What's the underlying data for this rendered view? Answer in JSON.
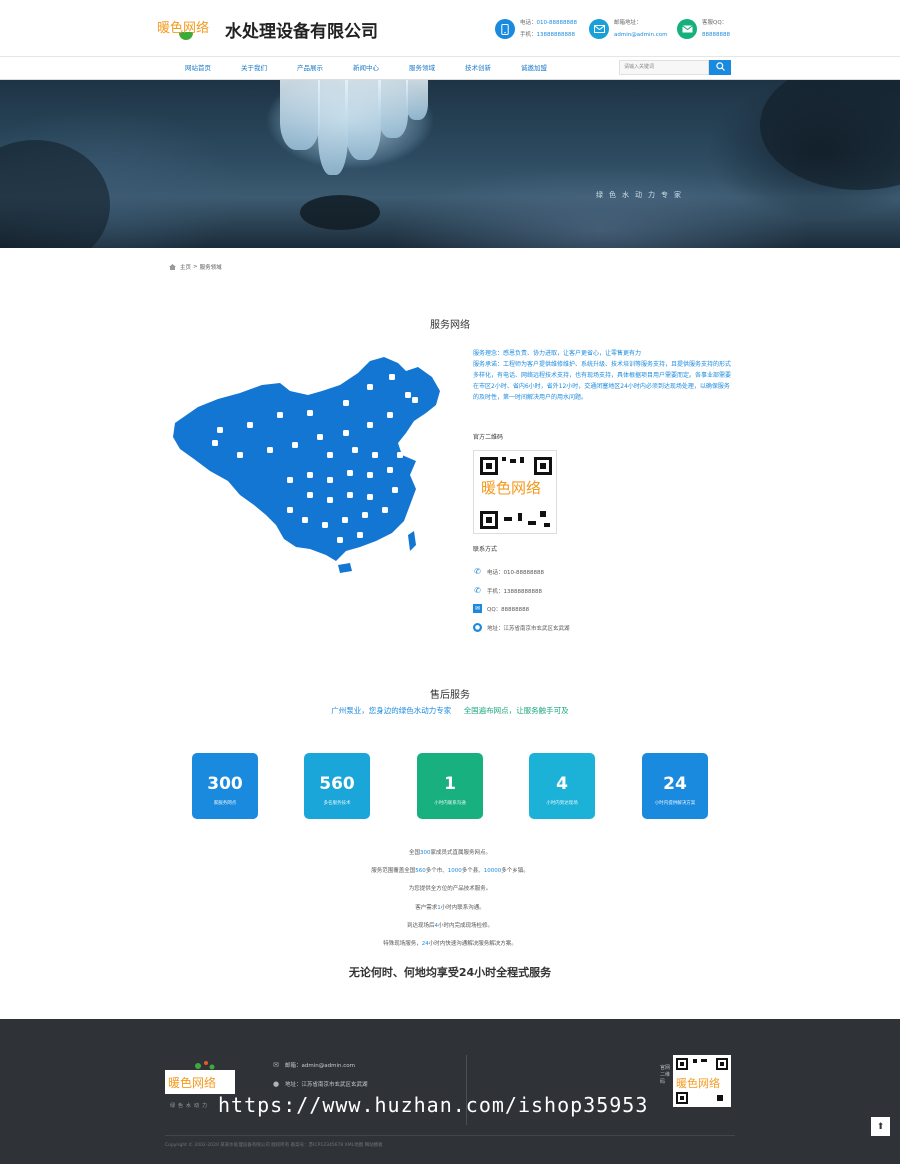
{
  "header": {
    "logo_text": "暖色网络",
    "company_name": "水处理设备有限公司",
    "phone_label": "电话：",
    "phone_value": "010-88888888",
    "mobile_label": "手机：",
    "mobile_value": "13888888888",
    "email_label": "邮箱地址：",
    "email_value": "admin@admin.com",
    "qq_label": "客服QQ：",
    "qq_value": "88888888",
    "colors": {
      "phone": "#1a8adf",
      "email": "#1aa0d8",
      "qq": "#16b07d"
    }
  },
  "nav": {
    "items": [
      "网站首页",
      "关于我们",
      "产品展示",
      "新闻中心",
      "服务领域",
      "技术创新",
      "诚邀加盟"
    ],
    "search_placeholder": "请输入关键词"
  },
  "banner": {
    "slogan": "绿色水动力专家"
  },
  "breadcrumb": {
    "home": "主页",
    "sep": ">",
    "current": "服务领域"
  },
  "service": {
    "title": "服务网络",
    "paragraph": "服务理念：感恩负责、协力进取，让客户更省心，让零售更有力\n服务承诺：工程师为客户提供维修维护、系统升级、技术培训等服务支持，且提供服务支持的形式多样化，有电话、网络远程技术支持，也有现场支持，具体根据项目用户需要而定。各事业部需要在市区2小时、省内6小时，省外12小时，交通闭塞地区24小时内必须到达现场处理，以确保服务的及时性，第一时间解决用户的用水问题。",
    "qr_label": "官方二维码",
    "qr_brand": "暖色网络",
    "contact_label": "联系方式",
    "contacts": [
      {
        "icon": "phone-icon",
        "text": "电话：010-88888888"
      },
      {
        "icon": "mobile-icon",
        "text": "手机：13888888888"
      },
      {
        "icon": "qq-icon",
        "text": "QQ：88888888"
      },
      {
        "icon": "location-icon",
        "text": "地址：江苏省南京市玄武区玄武湖"
      }
    ]
  },
  "after_sales": {
    "title": "售后服务",
    "sub_a": "广州泵业，您身边的绿色水动力专家",
    "sub_b": "全国遍布网点，让服务触手可及",
    "stats": [
      {
        "value": "300",
        "label": "家服务网点",
        "color": "#1a8adf"
      },
      {
        "value": "560",
        "label": "多名服务技术",
        "color": "#1aa6d8"
      },
      {
        "value": "1",
        "label": "小时内联系沟通",
        "color": "#17b07e"
      },
      {
        "value": "4",
        "label": "小时内到达现场",
        "color": "#1cb2d8"
      },
      {
        "value": "24",
        "label": "小时内提供解决方案",
        "color": "#1a8adf"
      }
    ],
    "lines": [
      [
        "全国",
        "300",
        "家成员式直属服务网点。"
      ],
      [
        "服务范围覆盖全国",
        "560",
        "多个市、",
        "1000",
        "多个县、",
        "10000",
        "多个乡镇。"
      ],
      [
        "为您提供全方位的产品技术服务。"
      ],
      [
        "客户需求",
        "1",
        "小时内联系沟通。"
      ],
      [
        "到达现场后",
        "4",
        "小时内完成现场检修。"
      ],
      [
        "特殊现场服务，",
        "24",
        "小时内快速沟通解决服务解决方案。"
      ]
    ],
    "slogan": "无论何时、何地均享受24小时全程式服务"
  },
  "footer": {
    "logo_text": "暖色网络",
    "logo_sub": "绿色水动力",
    "email": "邮箱：admin@admin.com",
    "address": "地址：江苏省南京市玄武区玄武湖",
    "qr_label": "官网二维码",
    "qr_brand": "暖色网络",
    "copyright": "Copyright © 2002-2020 某某水处理设备有限公司 版权所有 备案号：苏ICP12345678 XML地图 网站模板",
    "watermark": "https://www.huzhan.com/ishop35953"
  }
}
